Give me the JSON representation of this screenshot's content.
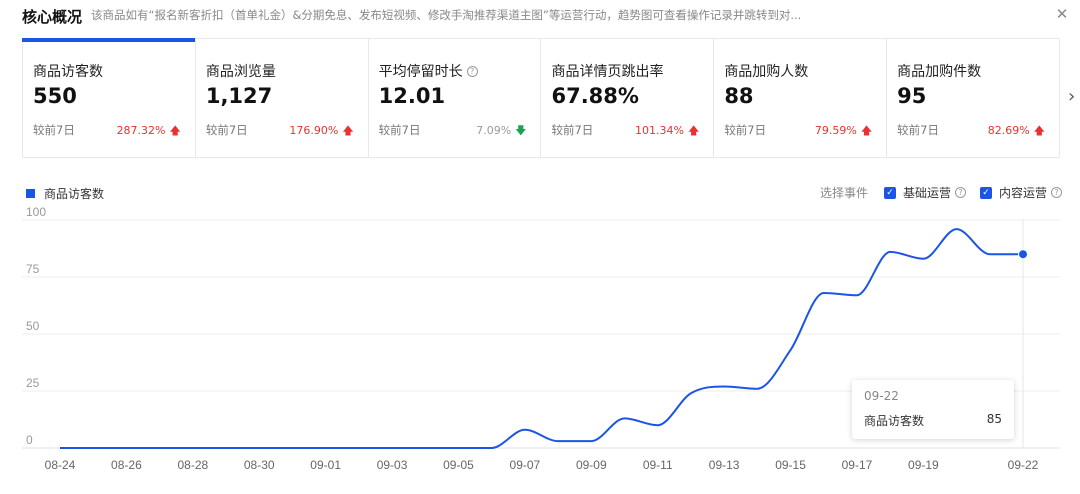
{
  "header": {
    "title": "核心概况",
    "description": "该商品如有“报名新客折扣（首单礼金）&分期免息、发布短视频、修改手淘推荐渠道主图”等运营行动，趋势图可查看操作记录并跳转到对...",
    "close_glyph": "✕"
  },
  "metrics": [
    {
      "label": "商品访客数",
      "value": "550",
      "compare": "较前7日",
      "change": "287.32%",
      "direction": "up"
    },
    {
      "label": "商品浏览量",
      "value": "1,127",
      "compare": "较前7日",
      "change": "176.90%",
      "direction": "up"
    },
    {
      "label": "平均停留时长",
      "value": "12.01",
      "compare": "较前7日",
      "change": "7.09%",
      "direction": "down",
      "help": "?"
    },
    {
      "label": "商品详情页跳出率",
      "value": "67.88%",
      "compare": "较前7日",
      "change": "101.34%",
      "direction": "up"
    },
    {
      "label": "商品加购人数",
      "value": "88",
      "compare": "较前7日",
      "change": "79.59%",
      "direction": "up"
    },
    {
      "label": "商品加购件数",
      "value": "95",
      "compare": "较前7日",
      "change": "82.69%",
      "direction": "up"
    }
  ],
  "icons": {
    "up": "arrow-up-icon",
    "down": "arrow-down-icon",
    "next": "chevron-right-icon",
    "help": "help-circle-icon",
    "check": "checkbox-checked-icon"
  },
  "legend": {
    "label": "商品访客数",
    "color": "#1a55e3"
  },
  "events": {
    "label": "选择事件",
    "items": [
      {
        "label": "基础运营",
        "checked": true
      },
      {
        "label": "内容运营",
        "checked": true
      }
    ]
  },
  "tooltip": {
    "date": "09-22",
    "name": "商品访客数",
    "value": "85"
  },
  "colors": {
    "accent": "#1a55e3",
    "up": "#e83232",
    "down": "#1aa352"
  },
  "chart_data": {
    "type": "line",
    "x": [
      "08-24",
      "08-25",
      "08-26",
      "08-27",
      "08-28",
      "08-29",
      "08-30",
      "08-31",
      "09-01",
      "09-02",
      "09-03",
      "09-04",
      "09-05",
      "09-06",
      "09-07",
      "09-08",
      "09-09",
      "09-10",
      "09-11",
      "09-12",
      "09-13",
      "09-14",
      "09-15",
      "09-16",
      "09-17",
      "09-18",
      "09-19",
      "09-20",
      "09-21",
      "09-22"
    ],
    "x_tick_labels": [
      "08-24",
      "08-26",
      "08-28",
      "08-30",
      "09-01",
      "09-03",
      "09-05",
      "09-07",
      "09-09",
      "09-11",
      "09-13",
      "09-15",
      "09-17",
      "09-19",
      "09-22"
    ],
    "series": [
      {
        "name": "商品访客数",
        "values": [
          0,
          0,
          0,
          0,
          0,
          0,
          0,
          0,
          0,
          0,
          0,
          0,
          0,
          0,
          8,
          3,
          3,
          13,
          10,
          24,
          27,
          26,
          43,
          68,
          67,
          86,
          83,
          96,
          85,
          85
        ]
      }
    ],
    "ylim": [
      0,
      100
    ],
    "y_ticks": [
      0,
      25,
      50,
      75,
      100
    ],
    "grid": true
  }
}
